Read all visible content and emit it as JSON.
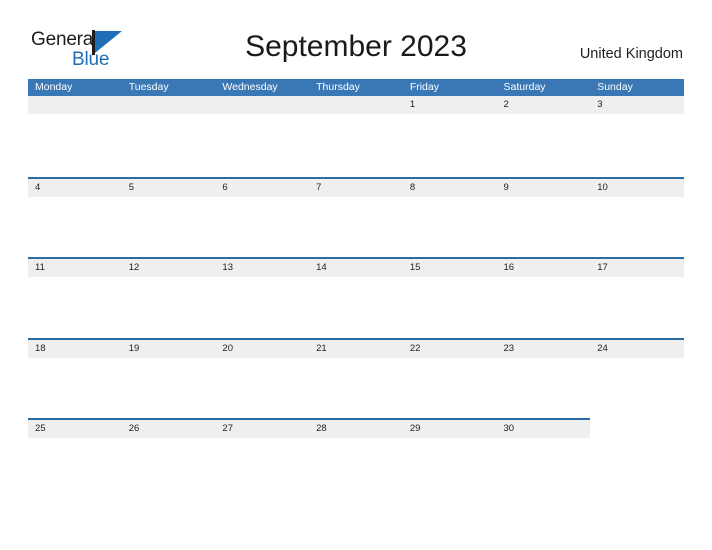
{
  "logo": {
    "word_one": "General",
    "word_two": "Blue",
    "mark": "triangle-flag-mark"
  },
  "header": {
    "title": "September 2023",
    "locale": "United Kingdom"
  },
  "colors": {
    "header_blue": "#3a77b5",
    "divider_blue": "#2a6ca6",
    "band_gray": "#efeff0",
    "logo_blue": "#1f6fb6",
    "text_dark": "#1a1a1a"
  },
  "calendar": {
    "weekday_headers": [
      "Monday",
      "Tuesday",
      "Wednesday",
      "Thursday",
      "Friday",
      "Saturday",
      "Sunday"
    ],
    "weeks": [
      {
        "days": [
          "",
          "",
          "",
          "",
          "1",
          "2",
          "3"
        ],
        "band_columns": 7
      },
      {
        "days": [
          "4",
          "5",
          "6",
          "7",
          "8",
          "9",
          "10"
        ],
        "band_columns": 7
      },
      {
        "days": [
          "11",
          "12",
          "13",
          "14",
          "15",
          "16",
          "17"
        ],
        "band_columns": 7
      },
      {
        "days": [
          "18",
          "19",
          "20",
          "21",
          "22",
          "23",
          "24"
        ],
        "band_columns": 7
      },
      {
        "days": [
          "25",
          "26",
          "27",
          "28",
          "29",
          "30",
          ""
        ],
        "band_columns": 6
      }
    ]
  }
}
